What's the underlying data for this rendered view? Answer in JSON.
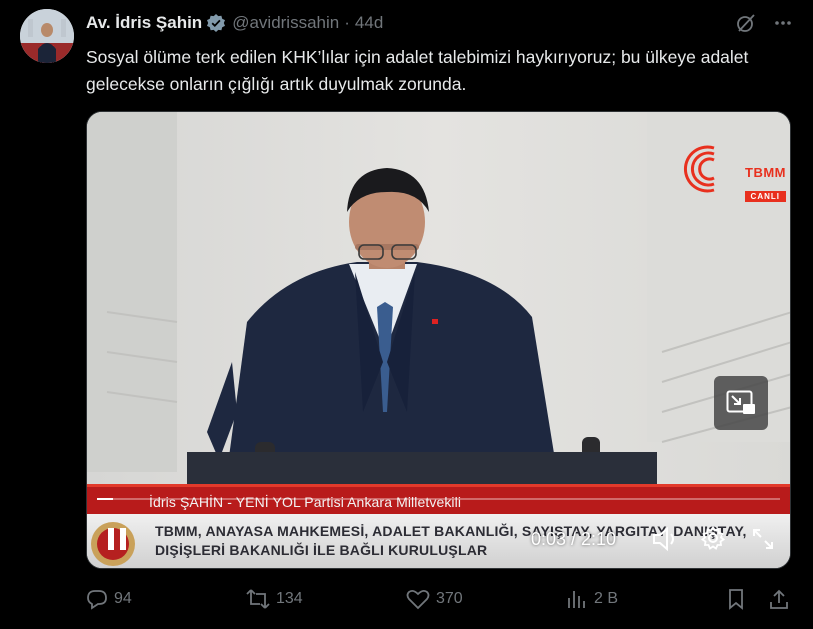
{
  "author": {
    "name": "Av. İdris Şahin",
    "handle": "@avidrissahin",
    "separator": "·",
    "time": "44d"
  },
  "tweet": {
    "text": "Sosyal ölüme terk edilen KHK’lılar için adalet talebimizi haykırıyoruz; bu ülkeye adalet gelecekse onların çığlığı artık duyulmak zorunda."
  },
  "video": {
    "channel_logo_text": "TBMM",
    "channel_live_text": "CANLI",
    "name_ticker": "İdris ŞAHİN - YENİ YOL Partisi Ankara Milletvekili",
    "ticker_line1": "TBMM, ANAYASA MAHKEMESİ, ADALET BAKANLIĞI, SAYIŞTAY, YARGITAY, DANIŞTAY,",
    "ticker_line2": "DIŞİŞLERİ BAKANLIĞI İLE BAĞLI KURULUŞLAR",
    "time_readout": "0:03 / 2:10",
    "progress_fraction": 0.023
  },
  "actions": {
    "replies": "94",
    "reposts": "134",
    "likes": "370",
    "views": "2 B"
  },
  "colors": {
    "background": "#000000",
    "text": "#e7e9ea",
    "muted": "#71767b",
    "verified": "#829aab",
    "tbmm_red": "#e8301e"
  }
}
